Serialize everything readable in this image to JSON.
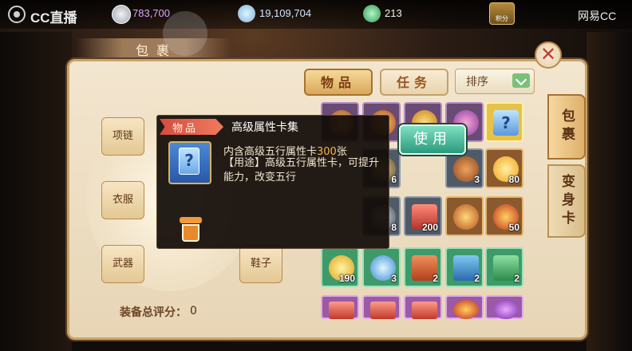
{
  "overlay": {
    "brand_left": "CC直播",
    "brand_right": "网易CC"
  },
  "resources": {
    "gold": "783,700",
    "silver": "19,109,704",
    "jade": "213",
    "badge_label": "积分"
  },
  "bag": {
    "title": "包裹",
    "tabs": {
      "items": "物品",
      "tasks": "任务"
    },
    "sort_label": "排序",
    "side_tabs": {
      "bag": "包裹",
      "transform": "变身卡"
    }
  },
  "equipment": {
    "slots": {
      "necklace": "项链",
      "clothes": "衣服",
      "weapon": "武器",
      "shoes": "鞋子"
    },
    "score_label": "装备总评分：",
    "score_value": "0"
  },
  "tooltip": {
    "tag": "物品",
    "title": "高级属性卡集",
    "desc_prefix": "内含高级五行属性卡",
    "desc_count": "300",
    "desc_suffix": "张",
    "usage": "【用途】高级五行属性卡，可提升能力，改变五行",
    "card_glyph": "?",
    "use_button": "使用"
  },
  "grid": {
    "row1": [
      "",
      "",
      "",
      "",
      "?"
    ],
    "row2": [
      "",
      "6",
      "3",
      "80"
    ],
    "row3": [
      "",
      "8",
      "200",
      "",
      "50"
    ],
    "row4": [
      "190",
      "3",
      "2",
      "2",
      "2"
    ],
    "row5": [
      "",
      "",
      "",
      "",
      ""
    ]
  },
  "colors": {
    "accent_red": "#d74b3e",
    "use_green": "#2a9a7c",
    "highlight_orange": "#f3b54a",
    "panel_bg": "#f3e6cf"
  }
}
